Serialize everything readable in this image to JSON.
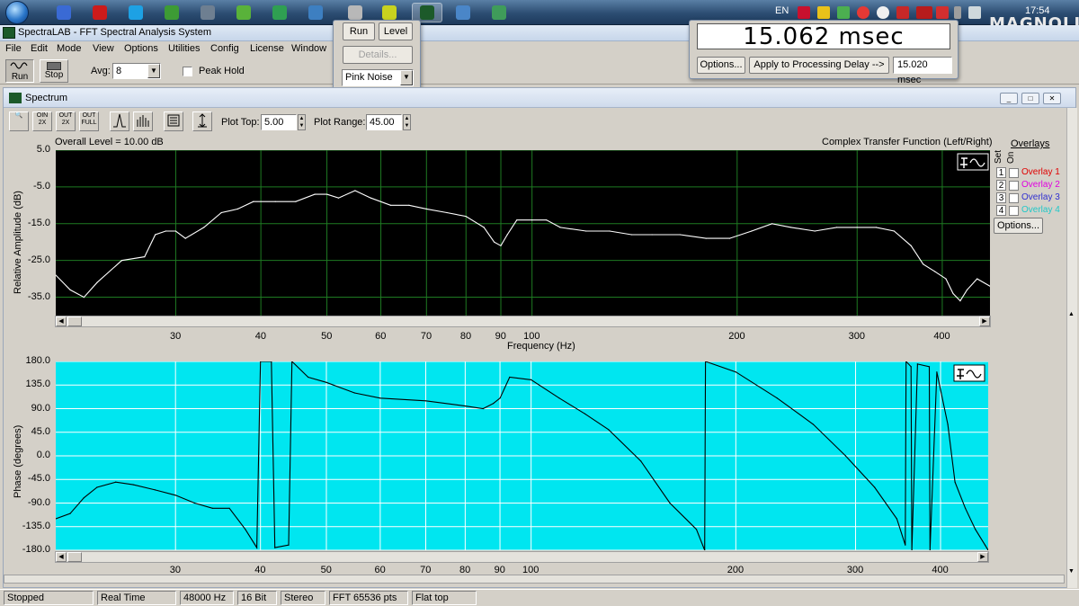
{
  "taskbar": {
    "language": "EN",
    "clock": "17:54",
    "brand": "MAGNOLIA",
    "apps": [
      {
        "name": "save-app",
        "color": "#3a6ad4"
      },
      {
        "name": "opera-app",
        "color": "#cc1b1b"
      },
      {
        "name": "skype-app",
        "color": "#1da1e4"
      },
      {
        "name": "browser-app",
        "color": "#3d9b35"
      },
      {
        "name": "tool-app",
        "color": "#6e7f91"
      },
      {
        "name": "media-app",
        "color": "#59b23a"
      },
      {
        "name": "wordpress-app",
        "color": "#2f9f52"
      },
      {
        "name": "ie-app",
        "color": "#3d7fc1"
      },
      {
        "name": "audio-app",
        "color": "#b8b8b8"
      },
      {
        "name": "spectralab-level-app",
        "color": "#c8d21f"
      },
      {
        "name": "spectralab-app",
        "color": "#1c5a2a"
      },
      {
        "name": "monitor-app",
        "color": "#4a86c8"
      },
      {
        "name": "display-app",
        "color": "#3f9c5a"
      }
    ]
  },
  "app": {
    "title": "SpectraLAB - FFT Spectral Analysis System",
    "menu": [
      "File",
      "Edit",
      "Mode",
      "View",
      "Options",
      "Utilities",
      "Config",
      "License",
      "Window"
    ]
  },
  "toolbar": {
    "run_label": "Run",
    "stop_label": "Stop",
    "avg_label": "Avg:",
    "avg_value": "8",
    "peak_hold_label": "Peak Hold"
  },
  "generator_panel": {
    "run_label": "Run",
    "level_label": "Level",
    "details_label": "Details...",
    "signal_value": "Pink Noise"
  },
  "delay_panel": {
    "readout": "15.062 msec",
    "options_label": "Options...",
    "apply_label": "Apply to Processing Delay -->",
    "delay_value": "15.020 msec"
  },
  "spectrum": {
    "window_title": "Spectrum",
    "plot_top_label": "Plot Top:",
    "plot_top_value": "5.00",
    "plot_range_label": "Plot Range:",
    "plot_range_value": "45.00",
    "overall_level": "Overall Level = 10.00 dB",
    "function_label": "Complex Transfer Function (Left/Right)",
    "overlays": {
      "title": "Overlays",
      "set_label": "Set",
      "on_label": "On",
      "items": [
        {
          "num": "1",
          "label": "Overlay 1",
          "color": "#e00000"
        },
        {
          "num": "2",
          "label": "Overlay 2",
          "color": "#e000e0"
        },
        {
          "num": "3",
          "label": "Overlay 3",
          "color": "#3030d0"
        },
        {
          "num": "4",
          "label": "Overlay 4",
          "color": "#20c8c8"
        }
      ],
      "options_label": "Options..."
    }
  },
  "chart_data": [
    {
      "type": "line",
      "name": "amplitude",
      "ylabel": "Relative Amplitude (dB)",
      "xlabel": "Frequency (Hz)",
      "x_scale": "log",
      "xlim": [
        20,
        470
      ],
      "ylim": [
        -40,
        5
      ],
      "yticks": [
        "5.0",
        "-5.0",
        "-15.0",
        "-25.0",
        "-35.0"
      ],
      "xticks": [
        "30",
        "40",
        "50",
        "60",
        "70",
        "80",
        "90",
        "100",
        "200",
        "300",
        "400"
      ],
      "background": "#000000",
      "line_color": "#ffffff",
      "grid_color": "#1e7a22",
      "x": [
        20,
        21,
        22,
        23,
        25,
        27,
        28,
        29,
        30,
        31,
        33,
        35,
        37,
        39,
        42,
        45,
        48,
        50,
        52,
        55,
        58,
        62,
        66,
        70,
        75,
        80,
        85,
        88,
        90,
        92,
        95,
        100,
        105,
        110,
        120,
        130,
        140,
        150,
        165,
        180,
        195,
        210,
        225,
        240,
        260,
        280,
        300,
        320,
        340,
        360,
        375,
        390,
        405,
        415,
        425,
        435,
        450,
        470
      ],
      "y": [
        -29,
        -33,
        -35,
        -31,
        -25,
        -24,
        -18,
        -17,
        -17,
        -19,
        -16,
        -12,
        -11,
        -9,
        -9,
        -9,
        -7,
        -7,
        -8,
        -6,
        -8,
        -10,
        -10,
        -11,
        -12,
        -13,
        -16,
        -20,
        -21,
        -18,
        -14,
        -14,
        -14,
        -16,
        -17,
        -17,
        -18,
        -18,
        -18,
        -19,
        -19,
        -17,
        -15,
        -16,
        -17,
        -16,
        -16,
        -16,
        -17,
        -21,
        -26,
        -28,
        -30,
        -34,
        -36,
        -33,
        -30,
        -32
      ]
    },
    {
      "type": "line",
      "name": "phase",
      "ylabel": "Phase (degrees)",
      "x_scale": "log",
      "xlim": [
        20,
        470
      ],
      "ylim": [
        -180,
        180
      ],
      "yticks": [
        "180.0",
        "135.0",
        "90.0",
        "45.0",
        "0.0",
        "-45.0",
        "-90.0",
        "-135.0",
        "-180.0"
      ],
      "xticks": [
        "30",
        "40",
        "50",
        "60",
        "70",
        "80",
        "90",
        "100",
        "200",
        "300",
        "400"
      ],
      "background": "#00e6f0",
      "line_color": "#000000",
      "grid_color": "#ffffff",
      "x": [
        20,
        21,
        22,
        23,
        24.5,
        26,
        28,
        30,
        32,
        34,
        36,
        38,
        39.5,
        40,
        41.5,
        42,
        44,
        44.5,
        47,
        50,
        55,
        60,
        70,
        80,
        85,
        88,
        90,
        93,
        100,
        110,
        120,
        130,
        145,
        160,
        175,
        180,
        180.5,
        200,
        230,
        260,
        290,
        320,
        345,
        355,
        356,
        362,
        363,
        370,
        385,
        386,
        395,
        410,
        420,
        435,
        450,
        465,
        470
      ],
      "y": [
        -120,
        -110,
        -80,
        -60,
        -50,
        -55,
        -65,
        -75,
        -90,
        -100,
        -100,
        -140,
        -175,
        180,
        180,
        -175,
        -170,
        180,
        150,
        140,
        120,
        110,
        105,
        95,
        90,
        100,
        110,
        150,
        145,
        110,
        80,
        50,
        -10,
        -90,
        -140,
        -180,
        180,
        160,
        110,
        60,
        0,
        -60,
        -120,
        -170,
        180,
        170,
        -180,
        175,
        170,
        -180,
        160,
        60,
        -50,
        -100,
        -140,
        -170,
        -180
      ]
    }
  ],
  "status": {
    "state": "Stopped",
    "mode": "Real Time",
    "sample_rate": "48000 Hz",
    "bits": "16 Bit",
    "channels": "Stereo",
    "fft": "FFT 65536 pts",
    "window": "Flat top"
  }
}
